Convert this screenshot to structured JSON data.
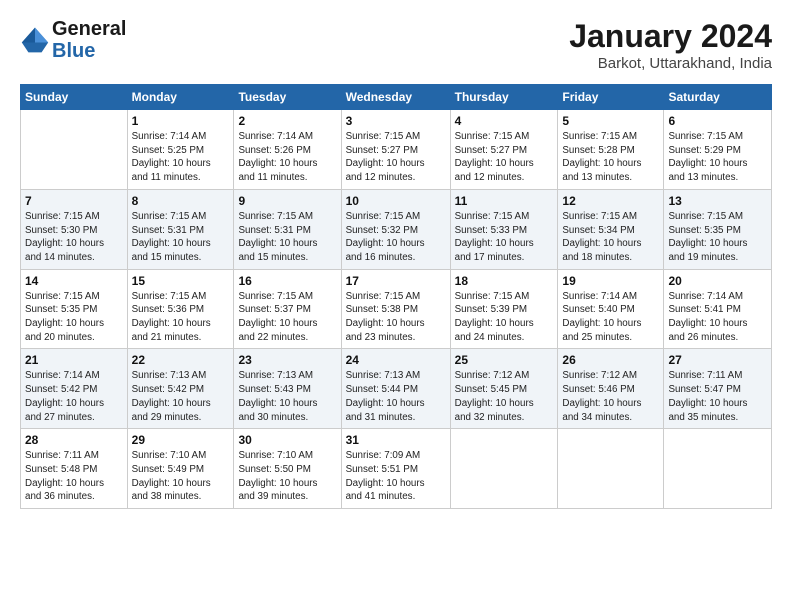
{
  "logo": {
    "line1": "General",
    "line2": "Blue"
  },
  "title": "January 2024",
  "subtitle": "Barkot, Uttarakhand, India",
  "days_of_week": [
    "Sunday",
    "Monday",
    "Tuesday",
    "Wednesday",
    "Thursday",
    "Friday",
    "Saturday"
  ],
  "weeks": [
    [
      {
        "day": "",
        "info": ""
      },
      {
        "day": "1",
        "info": "Sunrise: 7:14 AM\nSunset: 5:25 PM\nDaylight: 10 hours\nand 11 minutes."
      },
      {
        "day": "2",
        "info": "Sunrise: 7:14 AM\nSunset: 5:26 PM\nDaylight: 10 hours\nand 11 minutes."
      },
      {
        "day": "3",
        "info": "Sunrise: 7:15 AM\nSunset: 5:27 PM\nDaylight: 10 hours\nand 12 minutes."
      },
      {
        "day": "4",
        "info": "Sunrise: 7:15 AM\nSunset: 5:27 PM\nDaylight: 10 hours\nand 12 minutes."
      },
      {
        "day": "5",
        "info": "Sunrise: 7:15 AM\nSunset: 5:28 PM\nDaylight: 10 hours\nand 13 minutes."
      },
      {
        "day": "6",
        "info": "Sunrise: 7:15 AM\nSunset: 5:29 PM\nDaylight: 10 hours\nand 13 minutes."
      }
    ],
    [
      {
        "day": "7",
        "info": "Sunrise: 7:15 AM\nSunset: 5:30 PM\nDaylight: 10 hours\nand 14 minutes."
      },
      {
        "day": "8",
        "info": "Sunrise: 7:15 AM\nSunset: 5:31 PM\nDaylight: 10 hours\nand 15 minutes."
      },
      {
        "day": "9",
        "info": "Sunrise: 7:15 AM\nSunset: 5:31 PM\nDaylight: 10 hours\nand 15 minutes."
      },
      {
        "day": "10",
        "info": "Sunrise: 7:15 AM\nSunset: 5:32 PM\nDaylight: 10 hours\nand 16 minutes."
      },
      {
        "day": "11",
        "info": "Sunrise: 7:15 AM\nSunset: 5:33 PM\nDaylight: 10 hours\nand 17 minutes."
      },
      {
        "day": "12",
        "info": "Sunrise: 7:15 AM\nSunset: 5:34 PM\nDaylight: 10 hours\nand 18 minutes."
      },
      {
        "day": "13",
        "info": "Sunrise: 7:15 AM\nSunset: 5:35 PM\nDaylight: 10 hours\nand 19 minutes."
      }
    ],
    [
      {
        "day": "14",
        "info": "Sunrise: 7:15 AM\nSunset: 5:35 PM\nDaylight: 10 hours\nand 20 minutes."
      },
      {
        "day": "15",
        "info": "Sunrise: 7:15 AM\nSunset: 5:36 PM\nDaylight: 10 hours\nand 21 minutes."
      },
      {
        "day": "16",
        "info": "Sunrise: 7:15 AM\nSunset: 5:37 PM\nDaylight: 10 hours\nand 22 minutes."
      },
      {
        "day": "17",
        "info": "Sunrise: 7:15 AM\nSunset: 5:38 PM\nDaylight: 10 hours\nand 23 minutes."
      },
      {
        "day": "18",
        "info": "Sunrise: 7:15 AM\nSunset: 5:39 PM\nDaylight: 10 hours\nand 24 minutes."
      },
      {
        "day": "19",
        "info": "Sunrise: 7:14 AM\nSunset: 5:40 PM\nDaylight: 10 hours\nand 25 minutes."
      },
      {
        "day": "20",
        "info": "Sunrise: 7:14 AM\nSunset: 5:41 PM\nDaylight: 10 hours\nand 26 minutes."
      }
    ],
    [
      {
        "day": "21",
        "info": "Sunrise: 7:14 AM\nSunset: 5:42 PM\nDaylight: 10 hours\nand 27 minutes."
      },
      {
        "day": "22",
        "info": "Sunrise: 7:13 AM\nSunset: 5:42 PM\nDaylight: 10 hours\nand 29 minutes."
      },
      {
        "day": "23",
        "info": "Sunrise: 7:13 AM\nSunset: 5:43 PM\nDaylight: 10 hours\nand 30 minutes."
      },
      {
        "day": "24",
        "info": "Sunrise: 7:13 AM\nSunset: 5:44 PM\nDaylight: 10 hours\nand 31 minutes."
      },
      {
        "day": "25",
        "info": "Sunrise: 7:12 AM\nSunset: 5:45 PM\nDaylight: 10 hours\nand 32 minutes."
      },
      {
        "day": "26",
        "info": "Sunrise: 7:12 AM\nSunset: 5:46 PM\nDaylight: 10 hours\nand 34 minutes."
      },
      {
        "day": "27",
        "info": "Sunrise: 7:11 AM\nSunset: 5:47 PM\nDaylight: 10 hours\nand 35 minutes."
      }
    ],
    [
      {
        "day": "28",
        "info": "Sunrise: 7:11 AM\nSunset: 5:48 PM\nDaylight: 10 hours\nand 36 minutes."
      },
      {
        "day": "29",
        "info": "Sunrise: 7:10 AM\nSunset: 5:49 PM\nDaylight: 10 hours\nand 38 minutes."
      },
      {
        "day": "30",
        "info": "Sunrise: 7:10 AM\nSunset: 5:50 PM\nDaylight: 10 hours\nand 39 minutes."
      },
      {
        "day": "31",
        "info": "Sunrise: 7:09 AM\nSunset: 5:51 PM\nDaylight: 10 hours\nand 41 minutes."
      },
      {
        "day": "",
        "info": ""
      },
      {
        "day": "",
        "info": ""
      },
      {
        "day": "",
        "info": ""
      }
    ]
  ]
}
